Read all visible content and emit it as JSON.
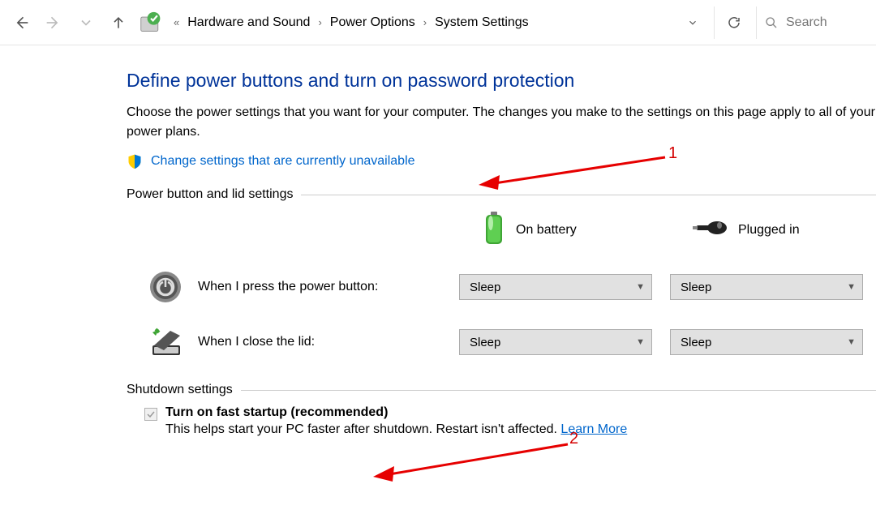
{
  "breadcrumbs": {
    "crumb1": "Hardware and Sound",
    "crumb2": "Power Options",
    "crumb3": "System Settings"
  },
  "search": {
    "placeholder": "Search"
  },
  "title": "Define power buttons and turn on password protection",
  "description": "Choose the power settings that you want for your computer. The changes you make to the settings on this page apply to all of your power plans.",
  "change_link": "Change settings that are currently unavailable",
  "sections": {
    "power_lid": "Power button and lid settings",
    "shutdown": "Shutdown settings"
  },
  "columns": {
    "battery": "On battery",
    "plugged": "Plugged in"
  },
  "rows": {
    "power_button": "When I press the power button:",
    "close_lid": "When I close the lid:"
  },
  "dropdowns": {
    "pb_battery": "Sleep",
    "pb_plugged": "Sleep",
    "lid_battery": "Sleep",
    "lid_plugged": "Sleep"
  },
  "shutdown_option": {
    "label": "Turn on fast startup (recommended)",
    "desc": "This helps start your PC faster after shutdown. Restart isn't affected. ",
    "learn_more": "Learn More"
  },
  "annotations": {
    "one": "1",
    "two": "2"
  }
}
